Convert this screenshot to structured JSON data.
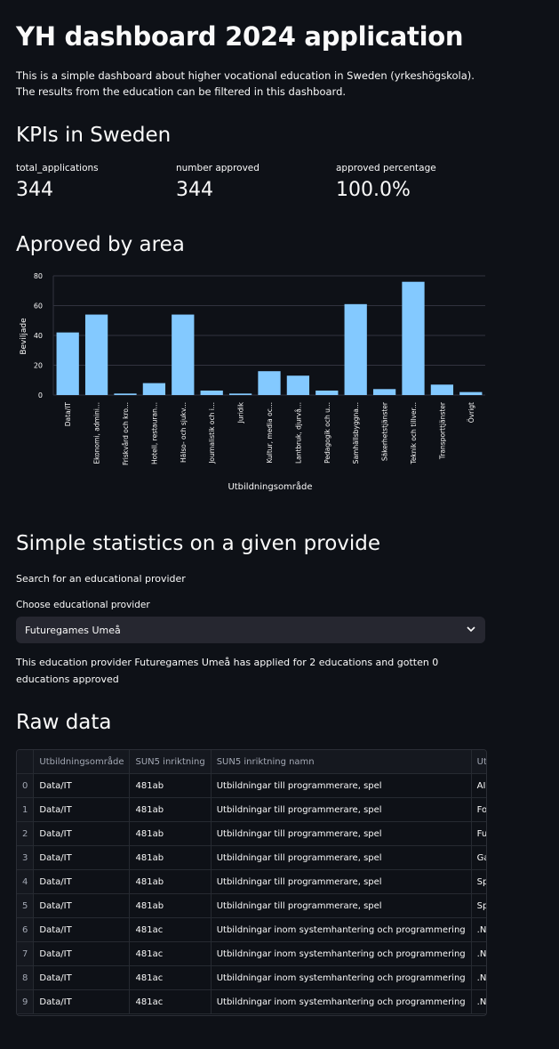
{
  "title": "YH dashboard 2024 application",
  "intro": "This is a simple dashboard about higher vocational education in Sweden (yrkeshögskola). The results from the education can be filtered in this dashboard.",
  "kpi_section": {
    "heading": "KPIs in Sweden",
    "items": [
      {
        "label": "total_applications",
        "value": "344"
      },
      {
        "label": "number approved",
        "value": "344"
      },
      {
        "label": "approved percentage",
        "value": "100.0%"
      }
    ]
  },
  "chart_section": {
    "heading": "Aproved by area"
  },
  "chart_data": {
    "type": "bar",
    "xlabel": "Utbildningsområde",
    "ylabel": "Beviljade",
    "ylim": [
      0,
      80
    ],
    "yticks": [
      0,
      20,
      40,
      60,
      80
    ],
    "grid": true,
    "bar_color": "#83c9ff",
    "categories": [
      "Data/IT",
      "Ekonomi, admini...",
      "Friskvård och kro...",
      "Hotell, restauran...",
      "Hälso- och sjukv...",
      "Journalistik och i...",
      "Juridik",
      "Kultur, media oc...",
      "Lantbruk, djurvå...",
      "Pedagogik och u...",
      "Samhällsbyggna...",
      "Säkerhetstjänster",
      "Teknik och tillver...",
      "Transporttjänster",
      "Övrigt"
    ],
    "values": [
      42,
      54,
      1,
      8,
      54,
      3,
      1,
      16,
      13,
      3,
      61,
      4,
      76,
      7,
      2
    ]
  },
  "provider_section": {
    "heading": "Simple statistics on a given provide",
    "search_label": "Search for an educational provider",
    "select_label": "Choose educational provider",
    "selected": "Futuregames Umeå",
    "result_text": "This education provider Futuregames Umeå has applied for 2 educations and gotten 0 educations approved"
  },
  "raw_section": {
    "heading": "Raw data",
    "columns": [
      "",
      "Utbildningsområde",
      "SUN5 inriktning",
      "SUN5 inriktning namn",
      "Utbildningsnamn"
    ],
    "rows": [
      [
        "0",
        "Data/IT",
        "481ab",
        "Utbildningar till programmerare, spel",
        "AI Progra"
      ],
      [
        "1",
        "Data/IT",
        "481ab",
        "Utbildningar till programmerare, spel",
        "Forsberg"
      ],
      [
        "2",
        "Data/IT",
        "481ab",
        "Utbildningar till programmerare, spel",
        "Futurega"
      ],
      [
        "3",
        "Data/IT",
        "481ab",
        "Utbildningar till programmerare, spel",
        "Game Pr"
      ],
      [
        "4",
        "Data/IT",
        "481ab",
        "Utbildningar till programmerare, spel",
        "Spelprog"
      ],
      [
        "5",
        "Data/IT",
        "481ab",
        "Utbildningar till programmerare, spel",
        "Spelprog"
      ],
      [
        "6",
        "Data/IT",
        "481ac",
        "Utbildningar inom systemhantering och programmering",
        ".NET Dev"
      ],
      [
        "7",
        "Data/IT",
        "481ac",
        "Utbildningar inom systemhantering och programmering",
        ".NET Dev"
      ],
      [
        "8",
        "Data/IT",
        "481ac",
        "Utbildningar inom systemhantering och programmering",
        ".NET Dev"
      ],
      [
        "9",
        "Data/IT",
        "481ac",
        "Utbildningar inom systemhantering och programmering",
        ".NET Utv"
      ]
    ]
  },
  "icons": {
    "select_arrow": "chevron-down-icon"
  }
}
